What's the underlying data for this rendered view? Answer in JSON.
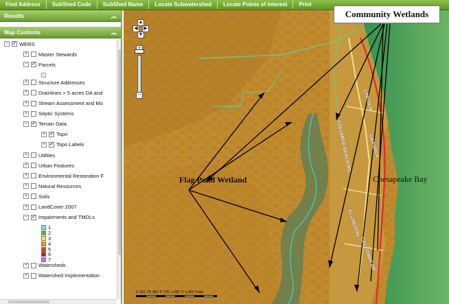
{
  "toolbar": {
    "buttons": [
      "Find Address",
      "SubShed Code",
      "SubShed Name",
      "Locate Subwatershed",
      "Locate Points of Interest",
      "Print"
    ]
  },
  "panels": {
    "results": {
      "title": "Results",
      "chevron": "︽"
    },
    "map_contents": {
      "title": "Map Contents",
      "chevron": "︽"
    }
  },
  "tree": {
    "root": {
      "label": "WERS",
      "checked": true,
      "expander": "⊟"
    },
    "items": [
      {
        "label": "Master Stewards",
        "checked": false,
        "expanded": false,
        "level": 1
      },
      {
        "label": "Parcels",
        "checked": true,
        "expanded": true,
        "level": 1
      },
      {
        "type": "swatch",
        "color": "#e6f7d8",
        "level": 2
      },
      {
        "label": "Structure Addresses",
        "checked": false,
        "expanded": false,
        "level": 1
      },
      {
        "label": "Drainlines > 5 acres DA and",
        "checked": false,
        "expanded": false,
        "level": 1
      },
      {
        "label": "Stream Assessment and Mo",
        "checked": false,
        "expanded": false,
        "level": 1
      },
      {
        "label": "Septic Systems",
        "checked": false,
        "expanded": false,
        "level": 1
      },
      {
        "label": "Terrain Data",
        "checked": true,
        "expanded": true,
        "level": 1
      },
      {
        "label": "Topo",
        "checked": true,
        "expanded": false,
        "level": 2
      },
      {
        "label": "Topo Labels",
        "checked": true,
        "expanded": false,
        "level": 2
      },
      {
        "label": "Utilities",
        "checked": false,
        "expanded": false,
        "level": 1
      },
      {
        "label": "Urban Features",
        "checked": false,
        "expanded": false,
        "level": 1
      },
      {
        "label": "Environmental Restoration F",
        "checked": false,
        "expanded": false,
        "level": 1
      },
      {
        "label": "Natural Resources",
        "checked": false,
        "expanded": false,
        "level": 1
      },
      {
        "label": "Soils",
        "checked": false,
        "expanded": false,
        "level": 1
      },
      {
        "label": "LandCover 2007",
        "checked": false,
        "expanded": false,
        "level": 1
      },
      {
        "label": "Impairments and TMDLs",
        "checked": true,
        "expanded": true,
        "level": 1
      },
      {
        "type": "legend",
        "label": "1",
        "color": "#8fd4f0",
        "level": 2
      },
      {
        "type": "legend",
        "label": "2",
        "color": "#5fb83a",
        "level": 2
      },
      {
        "type": "legend",
        "label": "3",
        "color": "#e8f04a",
        "level": 2
      },
      {
        "type": "legend",
        "label": "4",
        "color": "#f39a1c",
        "level": 2
      },
      {
        "type": "legend",
        "label": "5",
        "color": "#e7362a",
        "level": 2
      },
      {
        "type": "legend",
        "label": "6",
        "color": "#b81e1e",
        "level": 2
      },
      {
        "type": "legend",
        "label": "7",
        "color": "#d36be0",
        "level": 2
      },
      {
        "label": "Watersheds",
        "checked": false,
        "expanded": false,
        "level": 1
      },
      {
        "label": "Watershed Implementation",
        "checked": false,
        "expanded": false,
        "level": 1
      }
    ]
  },
  "map": {
    "annotations": {
      "community_wetlands": "Community Wetlands",
      "flag_pond_wetland": "Flag Pond Wetland",
      "chesapeake_bay": "Chesapeake Bay"
    },
    "road_labels": [
      "COLUMBIA BEACH RD",
      "LINCOLN",
      "ELLINGTON",
      "CALLOWAY DR",
      "GRANADA"
    ],
    "scale": {
      "ticks": [
        "0",
        "181.25",
        "362.5",
        "725",
        "1,087.5",
        "1,450 Feet"
      ]
    },
    "nav": {
      "pan_up": "▲",
      "pan_left": "◀",
      "pan_right": "▶",
      "pan_down": "▼",
      "zoom_in": "+",
      "zoom_out": "−"
    },
    "colors": {
      "land": "#c38a2a",
      "water": "#2f8a54",
      "bay": "#3d9a57",
      "shore": "#e02a2a",
      "stream": "#3fd0b8"
    }
  }
}
